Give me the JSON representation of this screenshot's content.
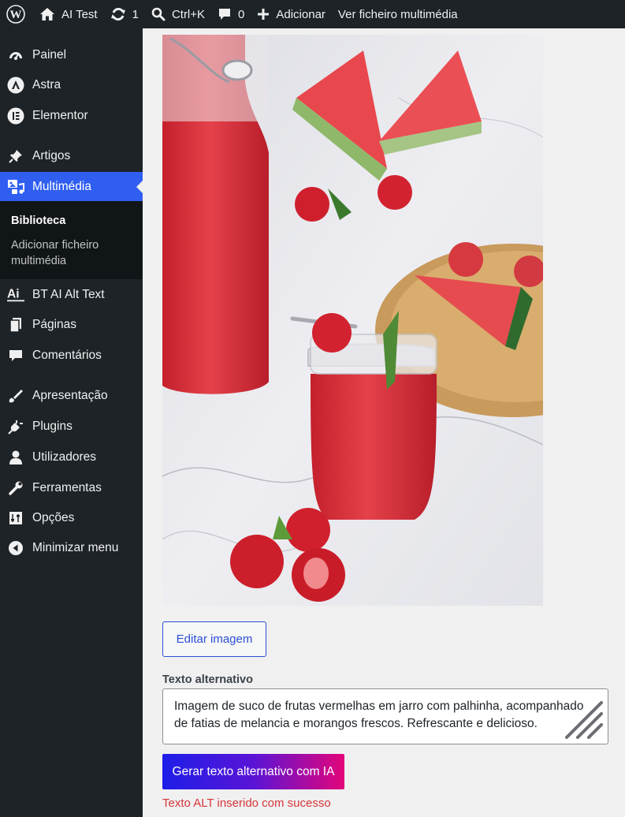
{
  "adminbar": {
    "wp_logo_icon": "wordpress-logo-icon",
    "site_name": "AI Test",
    "updates_count": "1",
    "search_shortcut": "Ctrl+K",
    "comments_count": "0",
    "add_new": "Adicionar",
    "view_media": "Ver ficheiro multimédia"
  },
  "sidebar": {
    "items": [
      {
        "label": "Painel",
        "icon": "dashboard-icon"
      },
      {
        "label": "Astra",
        "icon": "astra-icon"
      },
      {
        "label": "Elementor",
        "icon": "elementor-icon"
      },
      {
        "label": "Artigos",
        "icon": "pin-icon"
      },
      {
        "label": "Multimédia",
        "icon": "media-icon",
        "active": true
      },
      {
        "label": "BT AI Alt Text",
        "icon": "ai-alt-text-icon"
      },
      {
        "label": "Páginas",
        "icon": "pages-icon"
      },
      {
        "label": "Comentários",
        "icon": "comments-icon"
      },
      {
        "label": "Apresentação",
        "icon": "appearance-icon"
      },
      {
        "label": "Plugins",
        "icon": "plugins-icon"
      },
      {
        "label": "Utilizadores",
        "icon": "users-icon"
      },
      {
        "label": "Ferramentas",
        "icon": "tools-icon"
      },
      {
        "label": "Opções",
        "icon": "settings-icon"
      },
      {
        "label": "Minimizar menu",
        "icon": "collapse-icon"
      }
    ],
    "submenu": {
      "library": "Biblioteca",
      "add_new": "Adicionar ficheiro multimédia"
    }
  },
  "main": {
    "edit_image_button": "Editar imagem",
    "alt_text_label": "Texto alternativo",
    "alt_text_value": "Imagem de suco de frutas vermelhas em jarro com palhinha, acompanhado de fatias de melancia e morangos frescos. Refrescante e delicioso.",
    "generate_button": "Gerar texto alternativo com IA",
    "success_message": "Texto ALT inserido com sucesso"
  },
  "colors": {
    "adminbar_bg": "#1d2327",
    "menu_active": "#2f5ef0",
    "link_blue": "#2c4fd6",
    "gradient_start": "#1d1ee8",
    "gradient_end": "#e3057a",
    "success_text": "#d63638"
  }
}
